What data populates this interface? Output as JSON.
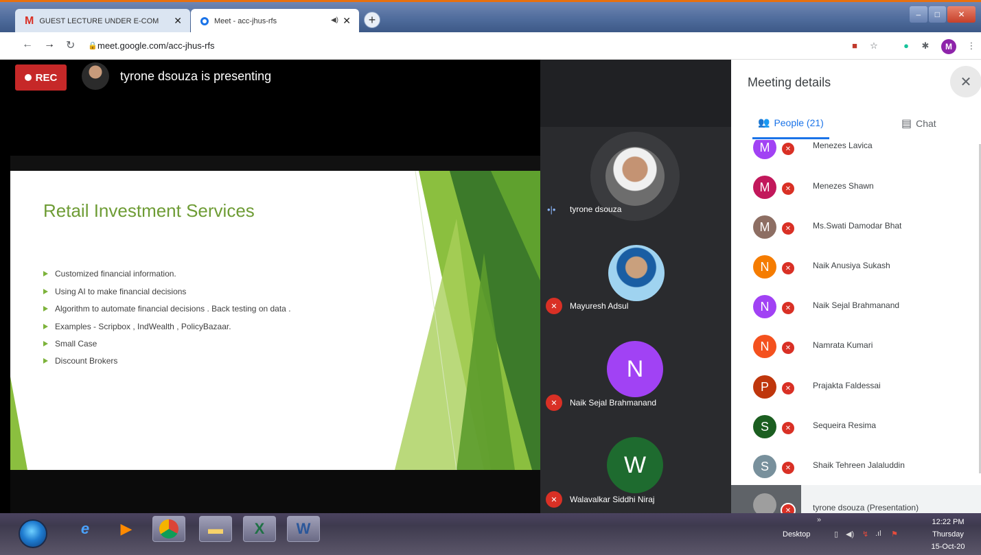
{
  "browser": {
    "tabs": [
      {
        "icon": "gmail-icon",
        "label": "GUEST LECTURE UNDER E-COM"
      },
      {
        "icon": "meet-icon",
        "label": "Meet - acc-jhus-rfs"
      }
    ],
    "url": "meet.google.com/acc-jhus-rfs"
  },
  "meet": {
    "rec_label": "REC",
    "presenting_text": "tyrone dsouza is presenting",
    "slide": {
      "title": "Retail Investment Services",
      "bullets": [
        "Customized financial information.",
        "Using AI to make financial decisions",
        "Algorithm to automate financial decisions . Back testing on data .",
        "Examples -  Scripbox , IndWealth , PolicyBazaar.",
        "Small Case",
        "Discount Brokers"
      ]
    },
    "tiles": [
      {
        "name": "tyrone dsouza",
        "initial": ""
      },
      {
        "name": "Mayuresh Adsul",
        "initial": ""
      },
      {
        "name": "Naik Sejal Brahmanand",
        "initial": "N",
        "color": "#a142f4"
      },
      {
        "name": "Walavalkar Siddhi Niraj",
        "initial": "W",
        "color": "#1e6b2f"
      }
    ]
  },
  "panel": {
    "title": "Meeting details",
    "people_tab": "People (21)",
    "chat_tab": "Chat",
    "people": [
      {
        "initial": "M",
        "name": "Menezes Lavica",
        "color": "#a142f4"
      },
      {
        "initial": "M",
        "name": "Menezes Shawn",
        "color": "#c2185b"
      },
      {
        "initial": "M",
        "name": "Ms.Swati Damodar Bhat",
        "color": "#8d6e63"
      },
      {
        "initial": "N",
        "name": "Naik Anusiya Sukash",
        "color": "#f57c00"
      },
      {
        "initial": "N",
        "name": "Naik Sejal Brahmanand",
        "color": "#a142f4"
      },
      {
        "initial": "N",
        "name": "Namrata Kumari",
        "color": "#f4511e"
      },
      {
        "initial": "P",
        "name": "Prajakta Faldessai",
        "color": "#bf360c"
      },
      {
        "initial": "S",
        "name": "Sequeira Resima",
        "color": "#1b5e20"
      },
      {
        "initial": "S",
        "name": "Shaik Tehreen Jalaluddin",
        "color": "#78909c"
      },
      {
        "initial": "",
        "name": "tyrone dsouza (Presentation)",
        "color": "#9e9e9e"
      }
    ]
  },
  "taskbar": {
    "desktop_label": "Desktop",
    "time": "12:22 PM",
    "day": "Thursday",
    "date": "15-Oct-20"
  },
  "colors": {
    "accent": "#1a73e8",
    "rec": "#c62828",
    "slide_title": "#6e9c35",
    "muted": "#d93025"
  }
}
